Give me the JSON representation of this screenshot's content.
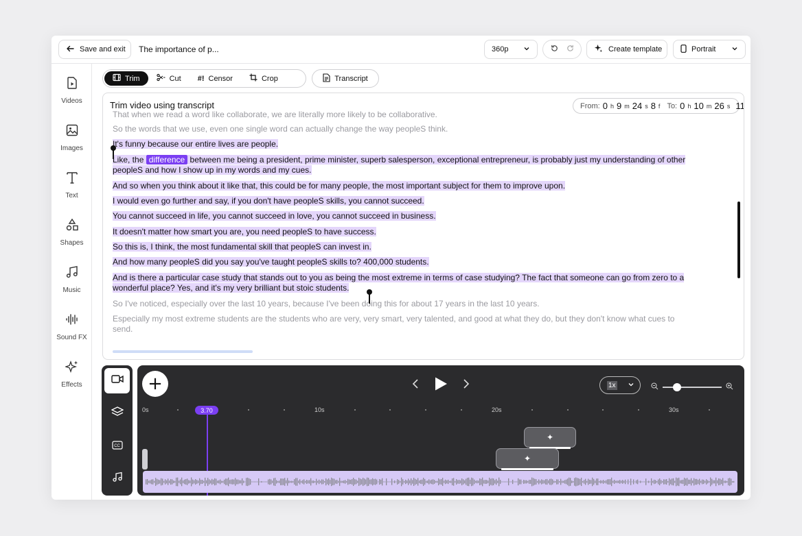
{
  "topbar": {
    "save_label": "Save and exit",
    "doc_title": "The importance of p...",
    "resolution": "360p",
    "create_template_label": "Create template",
    "orientation": "Portrait"
  },
  "sidebar": {
    "items": [
      {
        "label": "Videos",
        "icon": "video-file-icon"
      },
      {
        "label": "Images",
        "icon": "image-icon"
      },
      {
        "label": "Text",
        "icon": "text-icon"
      },
      {
        "label": "Shapes",
        "icon": "shapes-icon"
      },
      {
        "label": "Music",
        "icon": "music-note-icon"
      },
      {
        "label": "Sound FX",
        "icon": "waveform-icon"
      },
      {
        "label": "Effects",
        "icon": "sparkle-icon"
      }
    ]
  },
  "modes": {
    "trim": "Trim",
    "cut": "Cut",
    "censor": "Censor",
    "crop": "Crop",
    "transcript": "Transcript"
  },
  "panel": {
    "title": "Trim video using transcript",
    "from_label": "From:",
    "from": {
      "h": "0",
      "m": "9",
      "s": "24",
      "f": "8"
    },
    "to_label": "To:",
    "to": {
      "h": "0",
      "m": "10",
      "s": "26",
      "f": "11"
    },
    "units": {
      "h": "h",
      "m": "m",
      "s": "s",
      "f": "f"
    }
  },
  "transcript": {
    "line0": "That when we read a word like collaborate, we are literally more likely to be collaborative.",
    "line1": "So the words that we use, even one single word can actually change the way peopleS think.",
    "line2": "It's funny because our entire lives are people.",
    "line3_pre": "Like, the ",
    "line3_word": "difference",
    "line3_post": " between me being a president, prime minister, superb salesperson, exceptional entrepreneur, is probably just my understanding of other",
    "line3b": "peopleS and how I show up in my words and my cues.",
    "line4": "And so when you think about it like that, this could be for many people, the most important subject for them to improve upon.",
    "line5": "I would even go further and say, if you don't have peopleS skills, you cannot succeed.",
    "line6": "You cannot succeed in life, you cannot succeed in love, you cannot succeed in business.",
    "line7": "It doesn't matter how smart you are, you need peopleS to have success.",
    "line8": "So this is, I think, the most fundamental skill that peopleS can invest in.",
    "line9": "And how many peopleS did you say you've taught peopleS skills to? 400,000 students.",
    "line10a": "And is there a particular case study that stands out to you as being the most extreme in terms of case studying? The fact that someone can go from zero to a",
    "line10b": "wonderful place? Yes, and it's my very brilliant but stoic students.",
    "line11": "So I've noticed, especially over the last 10 years, because I've been doing this for about 17 years in the last 10 years.",
    "line12a": "Especially my most extreme students are the students who are very, very smart, very talented, and good at what they do, but they don't know what cues to",
    "line12b": "send."
  },
  "timeline": {
    "speed": "1x",
    "playhead": "3.70",
    "ticks": [
      "0s",
      "10s",
      "20s",
      "30s"
    ]
  },
  "colors": {
    "accent": "#7b3ff2",
    "selection": "#e4d6fb",
    "timeline_bg": "#2b2b2d",
    "audio_track": "#d6c9f6"
  }
}
